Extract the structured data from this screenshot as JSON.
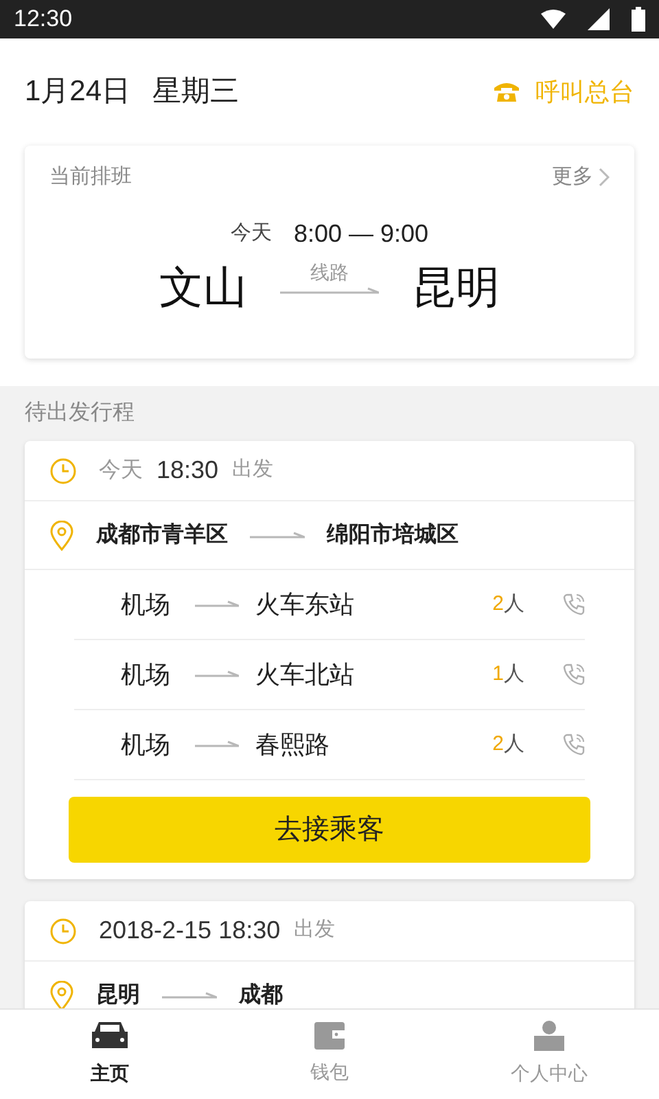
{
  "status_bar": {
    "time": "12:30"
  },
  "header": {
    "date": "1月24日",
    "weekday": "星期三",
    "call_label": "呼叫总台"
  },
  "current_shift": {
    "title": "当前排班",
    "more": "更多",
    "day": "今天",
    "time": "8:00 — 9:00",
    "from": "文山",
    "route_label": "线路",
    "to": "昆明"
  },
  "pending": {
    "title": "待出发行程",
    "trips": [
      {
        "day": "今天",
        "time": "18:30",
        "depart": "出发",
        "from": "成都市青羊区",
        "to": "绵阳市培城区",
        "stops": [
          {
            "from": "机场",
            "to": "火车东站",
            "count": "2",
            "unit": "人"
          },
          {
            "from": "机场",
            "to": "火车北站",
            "count": "1",
            "unit": "人"
          },
          {
            "from": "机场",
            "to": "春熙路",
            "count": "2",
            "unit": "人"
          }
        ],
        "action": "去接乘客"
      },
      {
        "time": "2018-2-15 18:30",
        "depart": "出发",
        "from": "昆明",
        "to": "成都"
      }
    ]
  },
  "tab_bar": [
    {
      "label": "主页",
      "kind": "car",
      "selected": true
    },
    {
      "label": "钱包",
      "kind": "wallet",
      "selected": false
    },
    {
      "label": "个人中心",
      "kind": "person",
      "selected": false
    }
  ]
}
